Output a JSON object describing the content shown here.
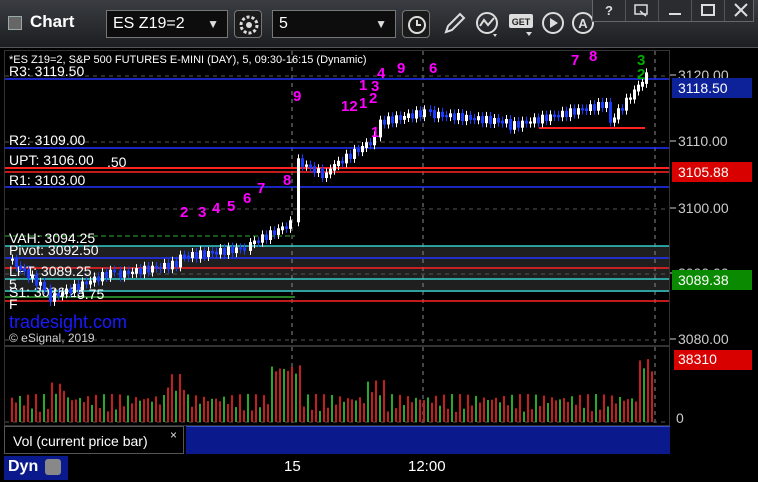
{
  "window": {
    "title": "Chart",
    "symbol": "ES Z19=2",
    "interval": "5"
  },
  "toolbar": {
    "icons": [
      "settings-icon",
      "clock-icon",
      "pencil-icon",
      "study-icon",
      "get-icon",
      "play-icon",
      "alert-icon"
    ],
    "get_label": "GET"
  },
  "chart": {
    "header": "*ES Z19=2, S&P 500 FUTURES E-MINI (DAY), 5, 09:30-16:15 (Dynamic)",
    "watermark": "tradesight.com",
    "copyright": "© eSignal, 2019",
    "price_ticks": [
      "3120.00",
      "3110.00",
      "3100.00",
      "3090.00",
      "3080.00"
    ],
    "price_boxes": [
      {
        "value": "3118.50",
        "bg": "#0d2299",
        "fg": "#ffffff"
      },
      {
        "value": "3105.88",
        "bg": "#d90000",
        "fg": "#ffffff"
      },
      {
        "value": "3089.38",
        "bg": "#0a8a00",
        "fg": "#ffffff"
      }
    ],
    "level_labels": [
      "R3: 3119.50",
      "R2: 3109.00",
      "UPT: 3106.00",
      "R1: 3103.00",
      "VAH: 3094.25",
      "Pivot: 3092.50",
      "LPT: 3089.25",
      "S1: 3086.25",
      ".50",
      "5.75",
      "5",
      "F"
    ],
    "count_labels": [
      "2",
      "3",
      "4",
      "5",
      "6",
      "7",
      "8",
      "9",
      "1",
      "3",
      "4",
      "9",
      "6",
      "12",
      "1",
      "2",
      "1",
      "7",
      "8",
      "3",
      "2"
    ],
    "colors": {
      "up_candle": "#ffffff",
      "down_candle": "#1a3cff",
      "count_magenta": "#ff00ff",
      "count_green": "#00aa00"
    }
  },
  "volume": {
    "panel_label": "Vol (current price bar)",
    "close": "×",
    "value_box": "38310",
    "zero_tick": "0"
  },
  "time_axis": {
    "labels": [
      "15",
      "12:00"
    ]
  },
  "statusbar": {
    "label": "Dyn"
  }
}
